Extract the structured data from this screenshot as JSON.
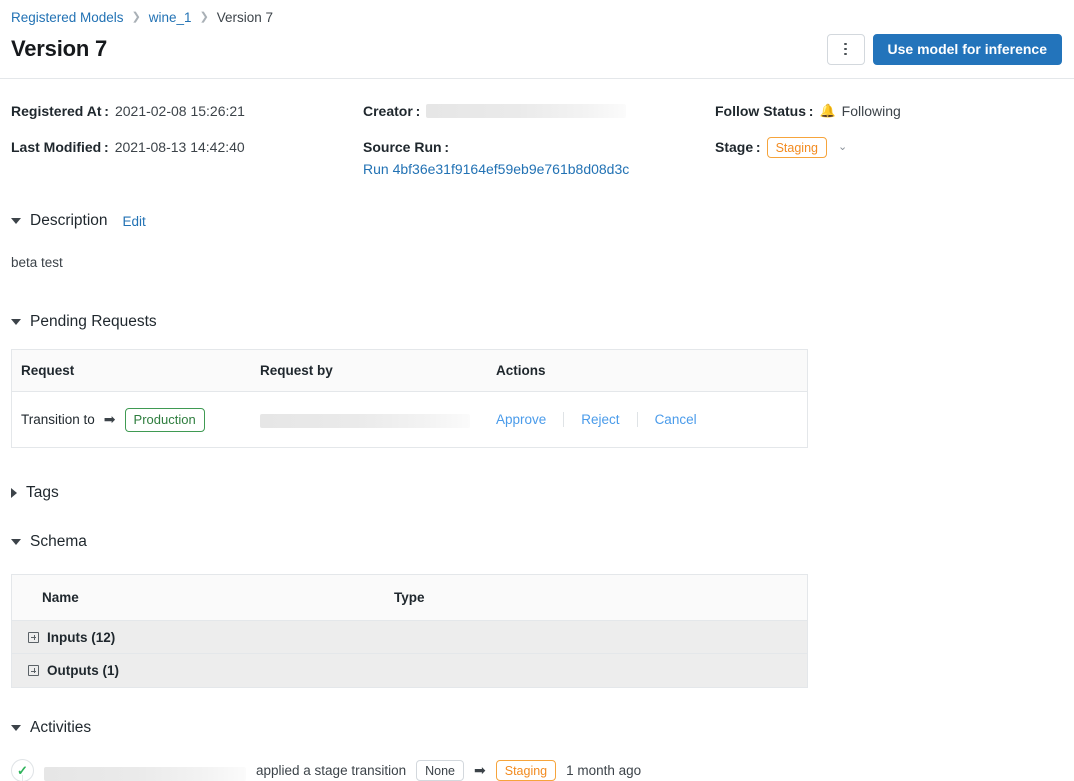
{
  "breadcrumb": {
    "items": [
      {
        "label": "Registered Models",
        "current": false
      },
      {
        "label": "wine_1",
        "current": false
      },
      {
        "label": "Version 7",
        "current": true
      }
    ],
    "separator": "❯"
  },
  "header": {
    "title": "Version 7",
    "kebab_label": "More options",
    "primary_button": "Use model for inference",
    "primary_color": "#2374bb"
  },
  "meta": {
    "registered_at_label": "Registered At :",
    "registered_at_value": "2021-02-08 15:26:21",
    "last_modified_label": "Last Modified :",
    "last_modified_value": "2021-08-13 14:42:40",
    "creator_label": "Creator :",
    "creator_value": "",
    "source_run_label": "Source Run :",
    "source_run_value": "Run 4bf36e31f9164ef59eb9e761b8d08d3c",
    "follow_status_label": "Follow Status :",
    "follow_status_value": "Following",
    "follow_icon": "bell-icon",
    "stage_label": "Stage :",
    "stage_value": "Staging",
    "stage_color": "#f28b20",
    "stage_caret": "⌄"
  },
  "description": {
    "title": "Description",
    "edit_label": "Edit",
    "body": "beta test",
    "expanded": true
  },
  "pending_requests": {
    "title": "Pending Requests",
    "expanded": true,
    "columns": [
      "Request",
      "Request by",
      "Actions"
    ],
    "rows": [
      {
        "request_prefix": "Transition to",
        "arrow": "➡",
        "request_stage": "Production",
        "request_stage_color": "#2e7d3e",
        "requested_by": "",
        "actions": [
          "Approve",
          "Reject",
          "Cancel"
        ]
      }
    ]
  },
  "tags": {
    "title": "Tags",
    "expanded": false
  },
  "schema": {
    "title": "Schema",
    "expanded": true,
    "columns": [
      "Name",
      "Type"
    ],
    "rows": [
      {
        "name": "Inputs (12)",
        "type": "",
        "icon": "plus-square-icon"
      },
      {
        "name": "Outputs (1)",
        "type": "",
        "icon": "plus-square-icon"
      }
    ]
  },
  "activities": {
    "title": "Activities",
    "expanded": true,
    "items": [
      {
        "status_icon": "check-circle-icon",
        "user": "",
        "text": "applied a stage transition",
        "from_stage": "None",
        "arrow": "➡",
        "to_stage": "Staging",
        "to_stage_color": "#f28b20",
        "time": "1 month ago"
      }
    ]
  }
}
